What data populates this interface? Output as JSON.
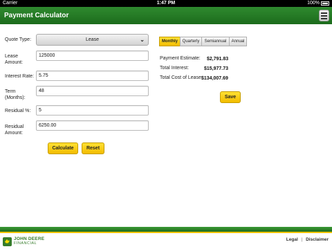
{
  "status_bar": {
    "carrier": "Carrier",
    "time": "1:47 PM",
    "battery": "100%"
  },
  "header": {
    "title": "Payment Calculator",
    "menu_icon": "hamburger-menu-icon"
  },
  "form": {
    "quote_type_label": "Quote Type:",
    "quote_type_value": "Lease",
    "lease_amount_label_1": "Lease",
    "lease_amount_label_2": "Amount:",
    "lease_amount_value": "125000",
    "interest_rate_label": "Interest Rate:",
    "interest_rate_value": "5.75",
    "term_label_1": "Term",
    "term_label_2": "(Months):",
    "term_value": "48",
    "residual_pct_label": "Residual %:",
    "residual_pct_value": "5",
    "residual_amount_label_1": "Residual",
    "residual_amount_label_2": "Amount:",
    "residual_amount_value": "6250.00",
    "calculate_label": "Calculate",
    "reset_label": "Reset"
  },
  "frequency": {
    "options": [
      "Monthly",
      "Quarterly",
      "Semiannual",
      "Annual"
    ],
    "selected": "Monthly"
  },
  "results": {
    "payment_estimate_label": "Payment Estimate:",
    "payment_estimate_value": "$2,791.83",
    "total_interest_label": "Total Interest:",
    "total_interest_value": "$15,977.73",
    "total_cost_label": "Total Cost of Lease:",
    "total_cost_value": "$134,007.69",
    "save_label": "Save"
  },
  "footer": {
    "brand_main": "JOHN DEERE",
    "brand_sub": "FINANCIAL",
    "legal_label": "Legal",
    "separator": "|",
    "disclaimer_label": "Disclaimer"
  },
  "colors": {
    "brand_green": "#367c2b",
    "header_green": "#1c6b1c",
    "accent_yellow": "#f2bc00"
  }
}
